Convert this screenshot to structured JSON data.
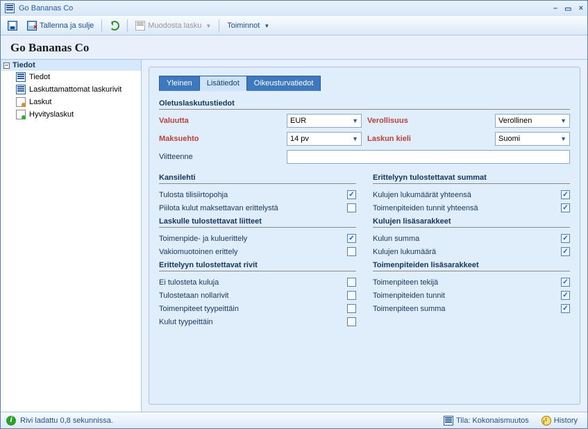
{
  "window": {
    "title": "Go Bananas Co"
  },
  "toolbar": {
    "save_close": "Tallenna ja sulje",
    "make_invoice": "Muodosta lasku",
    "actions": "Toiminnot"
  },
  "header": {
    "company": "Go Bananas Co"
  },
  "tree": {
    "root": "Tiedot",
    "items": [
      {
        "label": "Tiedot",
        "icon": "doc"
      },
      {
        "label": "Laskuttamattomat laskurivit",
        "icon": "doc"
      },
      {
        "label": "Laskut",
        "icon": "laskut"
      },
      {
        "label": "Hyvityslaskut",
        "icon": "hyv"
      }
    ]
  },
  "tabs": {
    "t0": "Yleinen",
    "t1": "Lisätiedot",
    "t2": "Oikeusturvatiedot"
  },
  "form": {
    "section_billing": "Oletuslaskutustiedot",
    "currency_label": "Valuutta",
    "currency_value": "EUR",
    "tax_label": "Verollisuus",
    "tax_value": "Verollinen",
    "terms_label": "Maksuehto",
    "terms_value": "14 pv",
    "lang_label": "Laskun kieli",
    "lang_value": "Suomi",
    "ref_label": "Viitteenne",
    "ref_value": ""
  },
  "col_left": {
    "sec1": "Kansilehti",
    "r1": "Tulosta tilisiirtopohja",
    "r2": "Piilota kulut maksettavan erittelystä",
    "sec2": "Laskulle tulostettavat liitteet",
    "r3": "Toimenpide- ja kuluerittely",
    "r4": "Vakiomuotoinen erittely",
    "sec3": "Erittelyyn tulostettavat rivit",
    "r5": "Ei tulosteta kuluja",
    "r6": "Tulostetaan nollarivit",
    "r7": "Toimenpiteet tyypeittäin",
    "r8": "Kulut tyypeittäin"
  },
  "col_right": {
    "sec1": "Erittelyyn tulostettavat summat",
    "r1": "Kulujen lukumäärät yhteensä",
    "r2": "Toimenpiteiden tunnit yhteensä",
    "sec2": "Kulujen lisäsarakkeet",
    "r3": "Kulun summa",
    "r4": "Kulujen lukumäärä",
    "sec3": "Toimenpiteiden lisäsarakkeet",
    "r5": "Toimenpiteen tekijä",
    "r6": "Toimenpiteiden tunnit",
    "r7": "Toimenpiteen summa"
  },
  "checks": {
    "l1": true,
    "l2": false,
    "l3": true,
    "l4": false,
    "l5": false,
    "l6": false,
    "l7": false,
    "l8": false,
    "r1": true,
    "r2": true,
    "r3": true,
    "r4": true,
    "r5": true,
    "r6": true,
    "r7": true
  },
  "status": {
    "left": "Rivi ladattu 0,8 sekunnissa.",
    "mode_prefix": "Tila:",
    "mode": "Kokonaismuutos",
    "history": "History"
  }
}
